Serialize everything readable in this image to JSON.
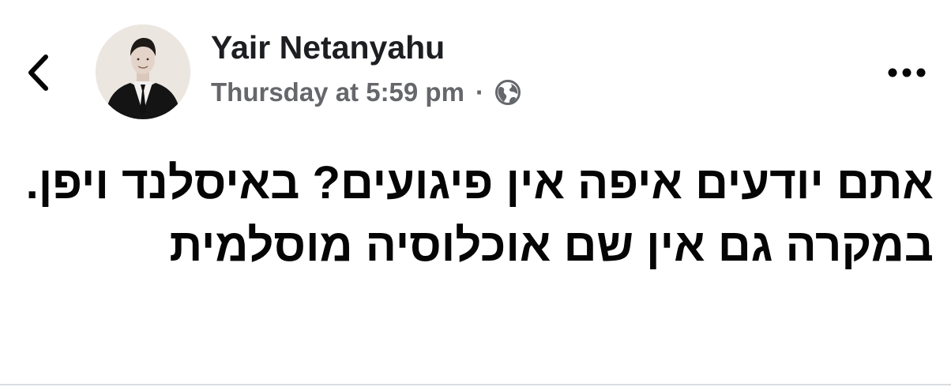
{
  "header": {
    "back_icon": "chevron-left-icon",
    "author_name": "Yair Netanyahu",
    "timestamp": "Thursday at 5:59 pm",
    "separator": "·",
    "audience_icon": "globe-icon",
    "more_icon": "ellipsis-icon"
  },
  "post": {
    "text": "אתם יודעים איפה אין פיגועים? באיסלנד ויפן. במקרה גם אין שם אוכלוסיה מוסלמית",
    "direction": "rtl"
  },
  "colors": {
    "text_primary": "#050505",
    "text_secondary": "#65676b",
    "divider": "#dadde1"
  }
}
